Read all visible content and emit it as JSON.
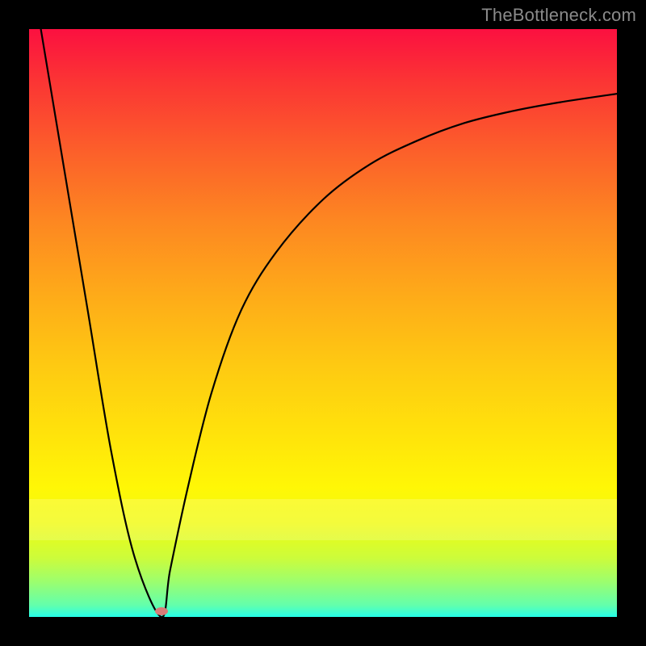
{
  "watermark": "TheBottleneck.com",
  "marker": {
    "x_pct": 22.5,
    "y_pct": 99.0,
    "color": "#d77c78"
  },
  "chart_data": {
    "type": "line",
    "title": "",
    "xlabel": "",
    "ylabel": "",
    "xlim": [
      0,
      100
    ],
    "ylim": [
      0,
      100
    ],
    "grid": false,
    "legend": false,
    "series": [
      {
        "name": "left-branch",
        "x": [
          2,
          6,
          10,
          14,
          18,
          22.5
        ],
        "values": [
          100,
          76,
          52,
          28,
          10,
          0
        ]
      },
      {
        "name": "right-branch",
        "x": [
          22.5,
          24,
          27,
          31,
          36,
          42,
          50,
          58,
          66,
          74,
          82,
          90,
          100
        ],
        "values": [
          0,
          8,
          22,
          38,
          52,
          62,
          71,
          77,
          81,
          84,
          86,
          87.5,
          89
        ]
      }
    ],
    "annotations": [
      {
        "text": "TheBottleneck.com",
        "position": "top-right"
      }
    ],
    "background_gradient": {
      "top": "#fb1040",
      "bottom": "#26ffe8",
      "stops": [
        "red",
        "orange",
        "yellow",
        "green",
        "cyan"
      ]
    }
  }
}
